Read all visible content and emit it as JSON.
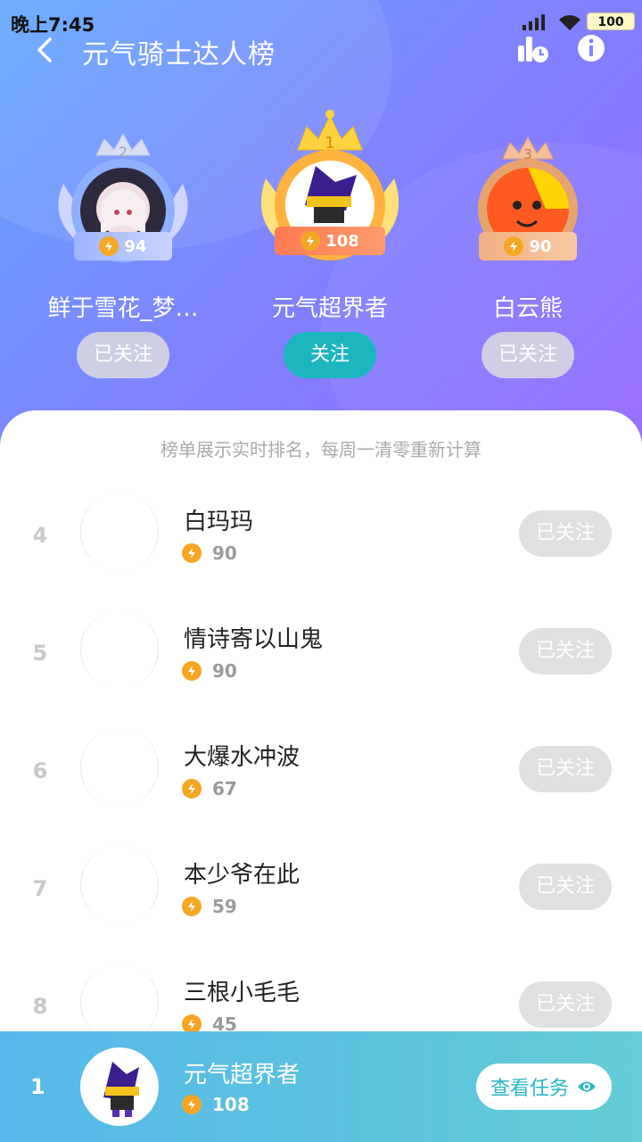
{
  "status_bar": {
    "time": "晚上7:45",
    "battery": "100"
  },
  "nav": {
    "title": "元气骑士达人榜"
  },
  "top3": [
    {
      "rank": "2",
      "name": "鲜于雪花_梦…",
      "score": "94",
      "button": "已关注"
    },
    {
      "rank": "1",
      "name": "元气超界者",
      "score": "108",
      "button": "关注"
    },
    {
      "rank": "3",
      "name": "白云熊",
      "score": "90",
      "button": "已关注"
    }
  ],
  "notice": "榜单展示实时排名，每周一清零重新计算",
  "list": [
    {
      "rank": "4",
      "name": "白玛玛",
      "score": "90",
      "button": "已关注"
    },
    {
      "rank": "5",
      "name": "情诗寄以山鬼",
      "score": "90",
      "button": "已关注"
    },
    {
      "rank": "6",
      "name": "大爆水冲波",
      "score": "67",
      "button": "已关注"
    },
    {
      "rank": "7",
      "name": "本少爷在此",
      "score": "59",
      "button": "已关注"
    },
    {
      "rank": "8",
      "name": "三根小毛毛",
      "score": "45",
      "button": "已关注"
    }
  ],
  "me": {
    "rank": "1",
    "name": "元气超界者",
    "score": "108",
    "button": "查看任务"
  },
  "colors": {
    "accent": "#1cb6bf",
    "bolt": "#f5a623",
    "gold": "#f7c948",
    "silver": "#b8c9ff",
    "bronze": "#e9a36e"
  }
}
